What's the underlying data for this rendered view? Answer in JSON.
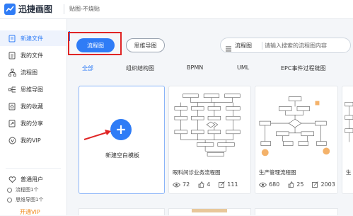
{
  "app": {
    "name": "迅捷画图",
    "tagline": "贴图-不烧贴"
  },
  "colors": {
    "accent": "#2f7cf6",
    "highlight": "#e02424",
    "vip": "#f08a1d"
  },
  "sidebar": {
    "items": [
      {
        "label": "新建文件",
        "icon": "new-file-icon"
      },
      {
        "label": "我的文件",
        "icon": "file-icon"
      },
      {
        "label": "流程图",
        "icon": "flowchart-icon"
      },
      {
        "label": "思维导图",
        "icon": "mindmap-icon"
      },
      {
        "label": "我的收藏",
        "icon": "collection-icon"
      },
      {
        "label": "我的分享",
        "icon": "share-icon"
      },
      {
        "label": "我的VIP",
        "icon": "vip-icon"
      }
    ],
    "user": {
      "label": "普通用户",
      "icon": "user-heart-icon"
    },
    "quotas": [
      "流程图1个",
      "思维导图1个"
    ],
    "vip_link": "开通VIP"
  },
  "toolbar": {
    "flowchart_btn": "流程图",
    "mindmap_btn": "思维导图"
  },
  "search": {
    "type": "流程图",
    "placeholder": "请输入搜索的流程图内容"
  },
  "categories": [
    "全部",
    "组织结构图",
    "BPMN",
    "UML",
    "EPC事件过程链图"
  ],
  "new_card": {
    "label": "新建空白模板"
  },
  "templates": [
    {
      "title": "眼科间诊业务流程图",
      "views": "72",
      "likes": "4",
      "copies": "111"
    },
    {
      "title": "生产管理流程图",
      "views": "680",
      "likes": "25",
      "copies": "2003"
    },
    {
      "title": "生"
    }
  ]
}
